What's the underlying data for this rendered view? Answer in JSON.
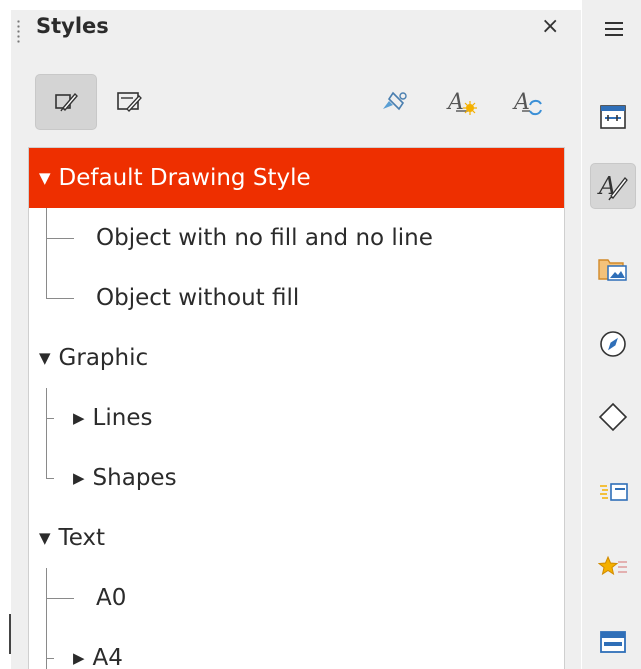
{
  "panel": {
    "title": "Styles",
    "close_glyph": "×",
    "menu_icon": "hamburger-icon"
  },
  "toolbar": {
    "buttons": [
      {
        "name": "drawing-styles-icon",
        "active": true
      },
      {
        "name": "presentation-styles-icon",
        "active": false
      },
      {
        "name": "fill-format-mode-icon",
        "active": false
      },
      {
        "name": "new-style-from-selection-icon",
        "active": false
      },
      {
        "name": "update-style-icon",
        "active": false
      }
    ]
  },
  "tree": {
    "items": [
      {
        "label": "Default Drawing Style",
        "expander": "▼",
        "selected": true
      },
      {
        "label": "Object with no fill and no line"
      },
      {
        "label": "Object without fill"
      },
      {
        "label": "Graphic",
        "expander": "▼"
      },
      {
        "label": "Lines",
        "expander": "▶"
      },
      {
        "label": "Shapes",
        "expander": "▶"
      },
      {
        "label": "Text",
        "expander": "▼"
      },
      {
        "label": "A0"
      },
      {
        "label": "A4",
        "expander": "▶"
      }
    ]
  },
  "sidebar": {
    "icons": [
      "properties-icon",
      "styles-icon",
      "gallery-icon",
      "navigator-icon",
      "shapes-icon",
      "animation-icon",
      "slide-transition-icon",
      "master-slides-icon"
    ],
    "active": "styles-icon"
  },
  "colors": {
    "selection": "#ee2f00",
    "panel_bg": "#efefef"
  }
}
